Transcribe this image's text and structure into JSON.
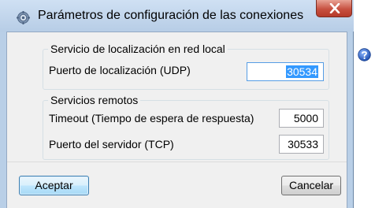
{
  "window": {
    "title": "Parámetros de configuración de las conexiones",
    "app_icon": "gear-settings-icon",
    "close_icon": "close-icon"
  },
  "local_location": {
    "group_title": "Servicio de localización en red local",
    "udp_port_label": "Puerto de localización (UDP)",
    "udp_port_value": "30534"
  },
  "remote_services": {
    "group_title": "Servicios remotos",
    "timeout_label": "Timeout (Tiempo de espera de respuesta)",
    "timeout_value": "5000",
    "server_port_label": "Puerto del servidor (TCP)",
    "server_port_value": "30533"
  },
  "buttons": {
    "accept_label": "Aceptar",
    "cancel_label": "Cancelar"
  },
  "help": {
    "icon": "help-icon"
  },
  "colors": {
    "titlebar": "#b9cfe7",
    "close_button": "#c75040",
    "selection": "#3399ff",
    "help_icon": "#2a62c9"
  }
}
